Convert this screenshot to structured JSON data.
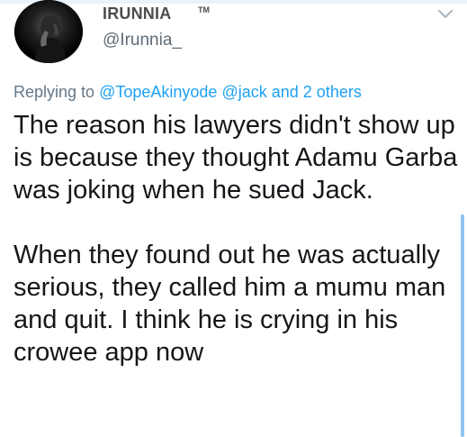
{
  "tweet": {
    "author": {
      "display_name": "IRUNNIA",
      "trademark": "TM",
      "handle": "@Irunnia_",
      "avatar_icon": "dark-hooded-figure-avatar"
    },
    "menu_icon": "chevron-down-icon",
    "reply_context": {
      "prefix": "Replying to",
      "mention_1": "@TopeAkinyode",
      "mention_2": "@jack",
      "suffix": "and 2 others"
    },
    "paragraphs": [
      "The reason his lawyers didn't show up is because they thought Adamu Garba was joking when he sued Jack.",
      "When they found out he was actually serious, they called him a mumu man and quit. I think he is crying in his crowee app now"
    ]
  },
  "colors": {
    "link": "#1da1f2",
    "secondary_text": "#657786",
    "primary_text": "#14171a",
    "scrollbar": "#8fc2ec"
  }
}
